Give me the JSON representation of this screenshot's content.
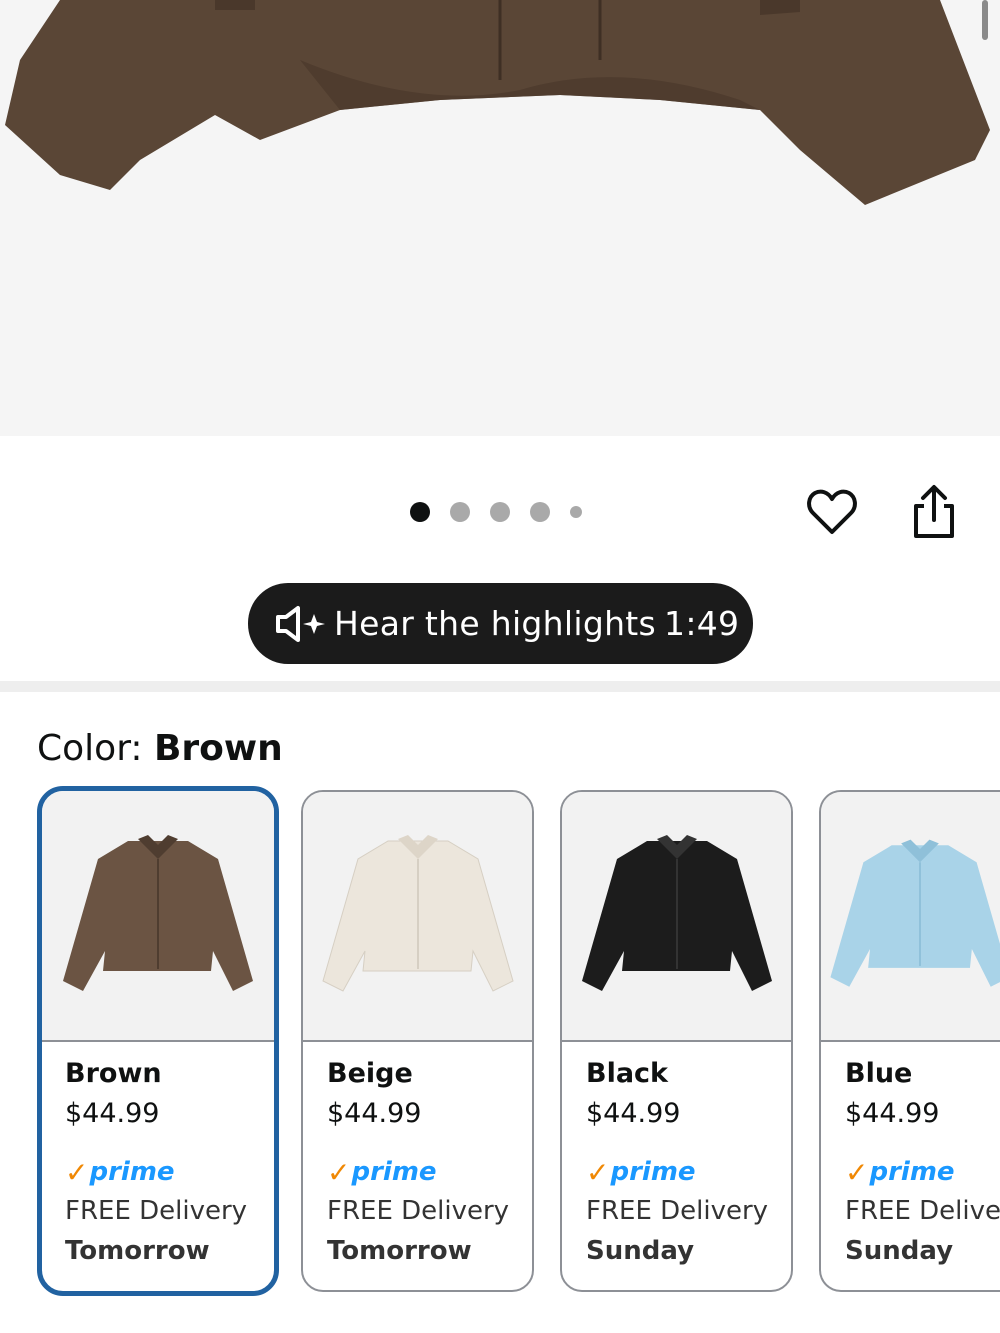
{
  "carousel": {
    "dot_count": 5,
    "active_index": 0
  },
  "audio": {
    "label": "Hear the highlights",
    "duration": "1:49"
  },
  "color_selector": {
    "prefix": "Color:",
    "selected": "Brown"
  },
  "swatches": [
    {
      "name": "Brown",
      "price": "$44.99",
      "prime_check": "✓",
      "prime": "prime",
      "delivery": "FREE Delivery",
      "day": "Tomorrow",
      "color": "#6b5443"
    },
    {
      "name": "Beige",
      "price": "$44.99",
      "prime_check": "✓",
      "prime": "prime",
      "delivery": "FREE Delivery",
      "day": "Tomorrow",
      "color": "#ece6dc"
    },
    {
      "name": "Black",
      "price": "$44.99",
      "prime_check": "✓",
      "prime": "prime",
      "delivery": "FREE Delivery",
      "day": "Sunday",
      "color": "#1c1c1c"
    },
    {
      "name": "Blue",
      "price": "$44.99",
      "prime_check": "✓",
      "prime": "prime",
      "delivery": "FREE Deliver",
      "day": "Sunday",
      "color": "#a9d3e8"
    }
  ],
  "colors": {
    "selected_border": "#2162a1",
    "prime_blue": "#1a98ff",
    "prime_check": "#f08804",
    "hero_jacket": "#5a4636"
  }
}
